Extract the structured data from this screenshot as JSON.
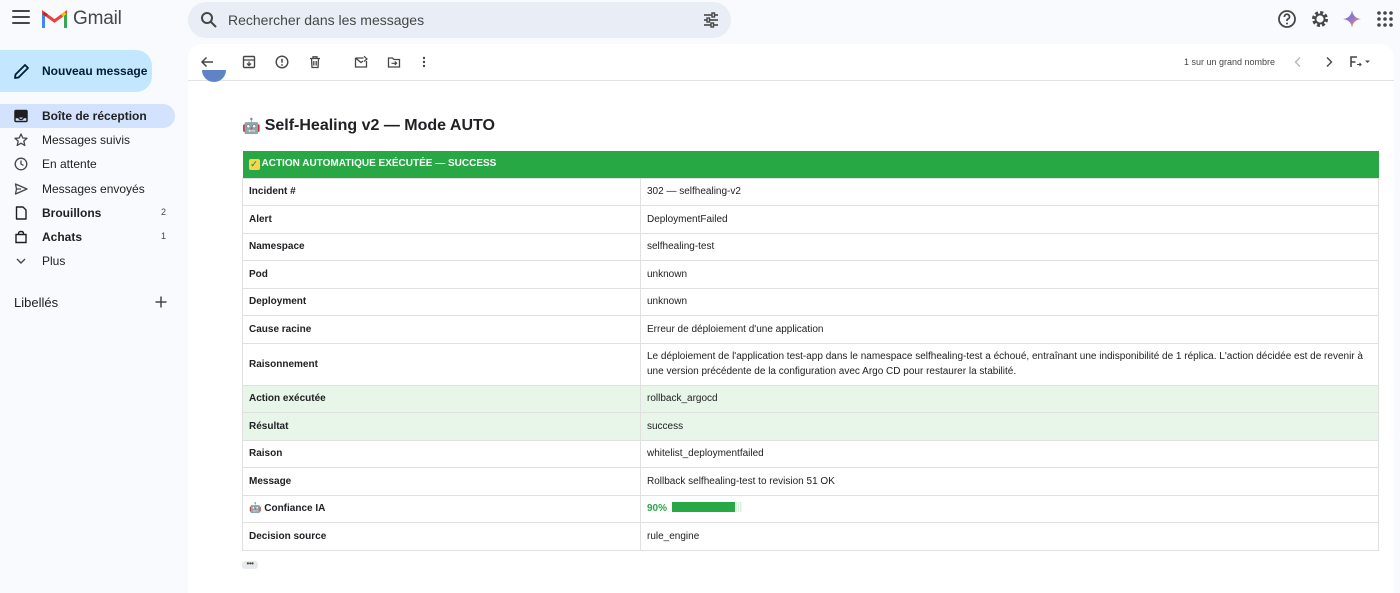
{
  "app": {
    "name": "Gmail"
  },
  "search": {
    "placeholder": "Rechercher dans les messages"
  },
  "sidebar": {
    "compose_label": "Nouveau message",
    "items": [
      {
        "label": "Boîte de réception",
        "icon": "inbox-icon",
        "count": "",
        "bold": true,
        "active": true
      },
      {
        "label": "Messages suivis",
        "icon": "star-icon",
        "count": "",
        "bold": false,
        "active": false
      },
      {
        "label": "En attente",
        "icon": "clock-icon",
        "count": "",
        "bold": false,
        "active": false
      },
      {
        "label": "Messages envoyés",
        "icon": "send-icon",
        "count": "",
        "bold": false,
        "active": false
      },
      {
        "label": "Brouillons",
        "icon": "draft-icon",
        "count": "2",
        "bold": true,
        "active": false
      },
      {
        "label": "Achats",
        "icon": "shopping-icon",
        "count": "1",
        "bold": true,
        "active": false
      },
      {
        "label": "Plus",
        "icon": "chevron-down-icon",
        "count": "",
        "bold": false,
        "active": false
      }
    ],
    "labels_heading": "Libellés"
  },
  "toolbar": {
    "pagination": "1 sur un grand nombre"
  },
  "email": {
    "subject_emoji": "🤖",
    "subject": "Self-Healing v2 — Mode AUTO",
    "banner": "ACTION AUTOMATIQUE EXÉCUTÉE — SUCCESS",
    "rows": [
      {
        "key": "Incident #",
        "value": "302 — selfhealing-v2"
      },
      {
        "key": "Alert",
        "value": "DeploymentFailed"
      },
      {
        "key": "Namespace",
        "value": "selfhealing-test"
      },
      {
        "key": "Pod",
        "value": "unknown"
      },
      {
        "key": "Deployment",
        "value": "unknown"
      },
      {
        "key": "Cause racine",
        "value": "Erreur de déploiement d'une application"
      },
      {
        "key": "Raisonnement",
        "value": "Le déploiement de l'application test-app dans le namespace selfhealing-test a échoué, entraînant une indisponibilité de 1 réplica. L'action décidée est de revenir à une version précédente de la configuration avec Argo CD pour restaurer la stabilité."
      },
      {
        "key": "Action exécutée",
        "value": "rollback_argocd"
      },
      {
        "key": "Résultat",
        "value": "success"
      },
      {
        "key": "Raison",
        "value": "whitelist_deploymentfailed"
      },
      {
        "key": "Message",
        "value": "Rollback selfhealing-test to revision 51 OK"
      }
    ],
    "confidence": {
      "emoji": "🤖",
      "label": "Confiance IA",
      "value": "90%",
      "fraction": 0.9
    },
    "decision": {
      "key": "Decision source",
      "value": "rule_engine"
    }
  },
  "colors": {
    "accent_green": "#28a745",
    "highlight_green": "#e8f5e9",
    "compose_bg": "#c2e7ff",
    "active_nav_bg": "#d3e3fd"
  }
}
